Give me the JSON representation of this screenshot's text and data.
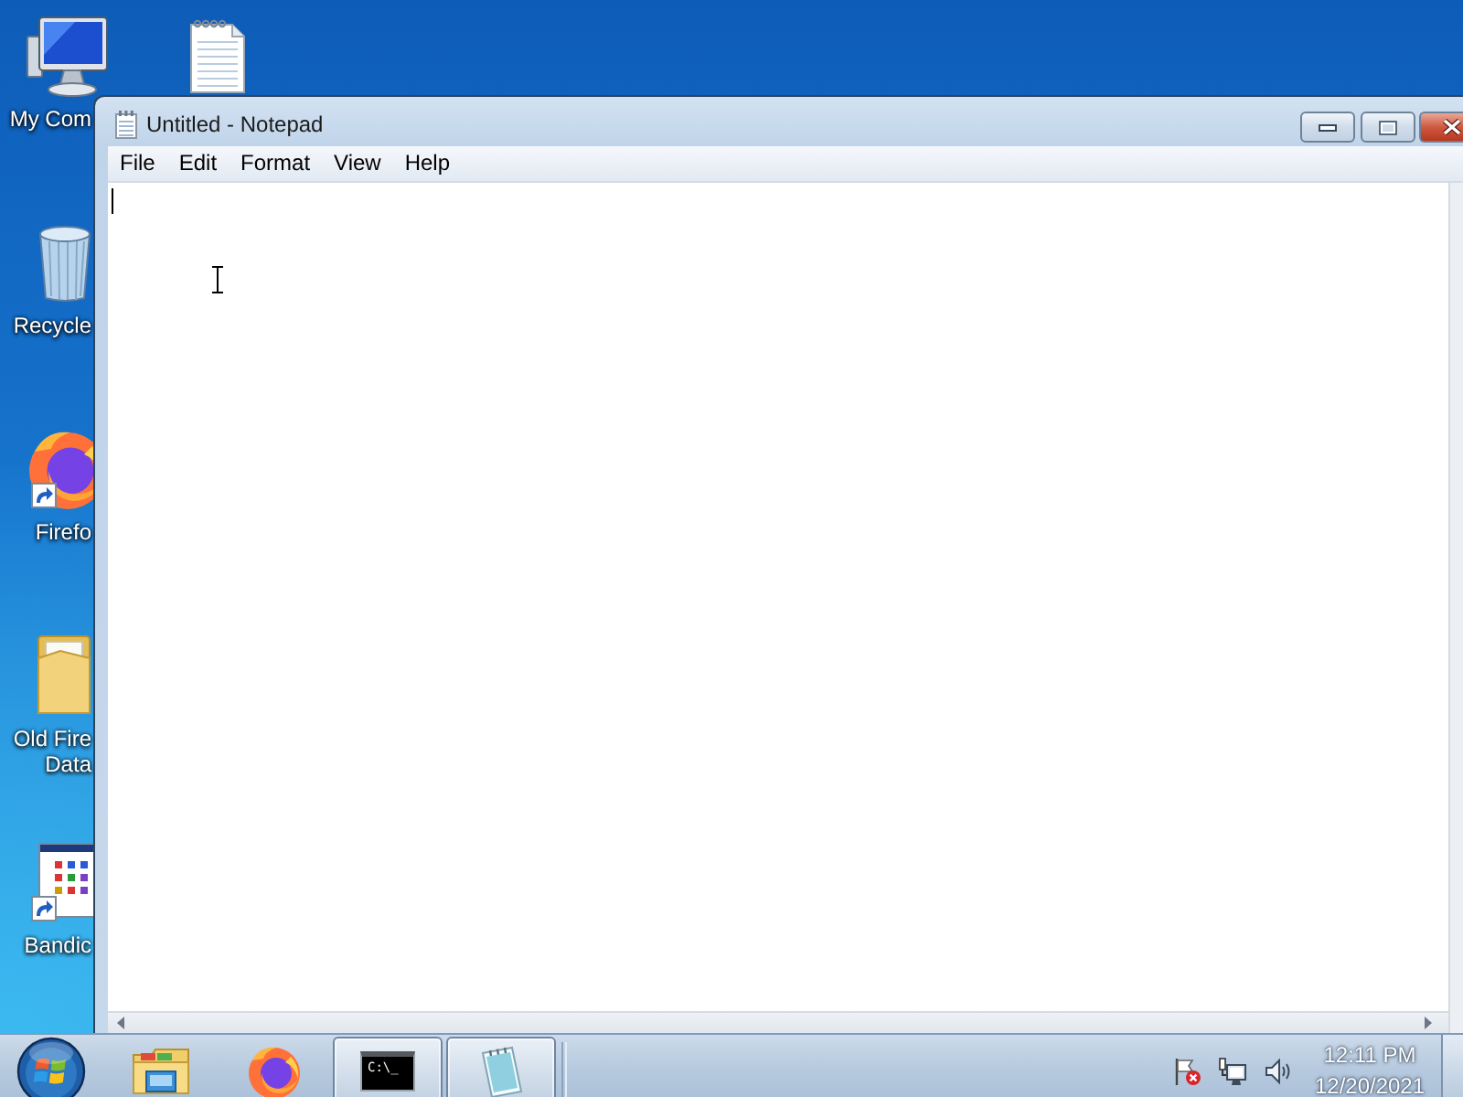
{
  "desktop": {
    "icons": [
      {
        "kind": "computer",
        "label": "My Com",
        "shortcut": false
      },
      {
        "kind": "recycle-bin",
        "label": "Recycle",
        "shortcut": false
      },
      {
        "kind": "firefox",
        "label": "Firefo",
        "shortcut": true
      },
      {
        "kind": "folder",
        "label": "Old Fire Data",
        "shortcut": false
      },
      {
        "kind": "app",
        "label": "Bandic",
        "shortcut": true
      },
      {
        "kind": "document",
        "shortcut": false
      }
    ]
  },
  "window": {
    "title": "Untitled - Notepad",
    "menu": [
      "File",
      "Edit",
      "Format",
      "View",
      "Help"
    ]
  },
  "taskbar": {
    "items": [
      {
        "kind": "explorer",
        "open": false
      },
      {
        "kind": "firefox",
        "open": false
      },
      {
        "kind": "terminal",
        "open": true,
        "icon_text": "C:\\_"
      },
      {
        "kind": "notepad",
        "open": true
      }
    ],
    "clock": {
      "time": "12:11 PM",
      "date": "12/20/2021"
    }
  }
}
